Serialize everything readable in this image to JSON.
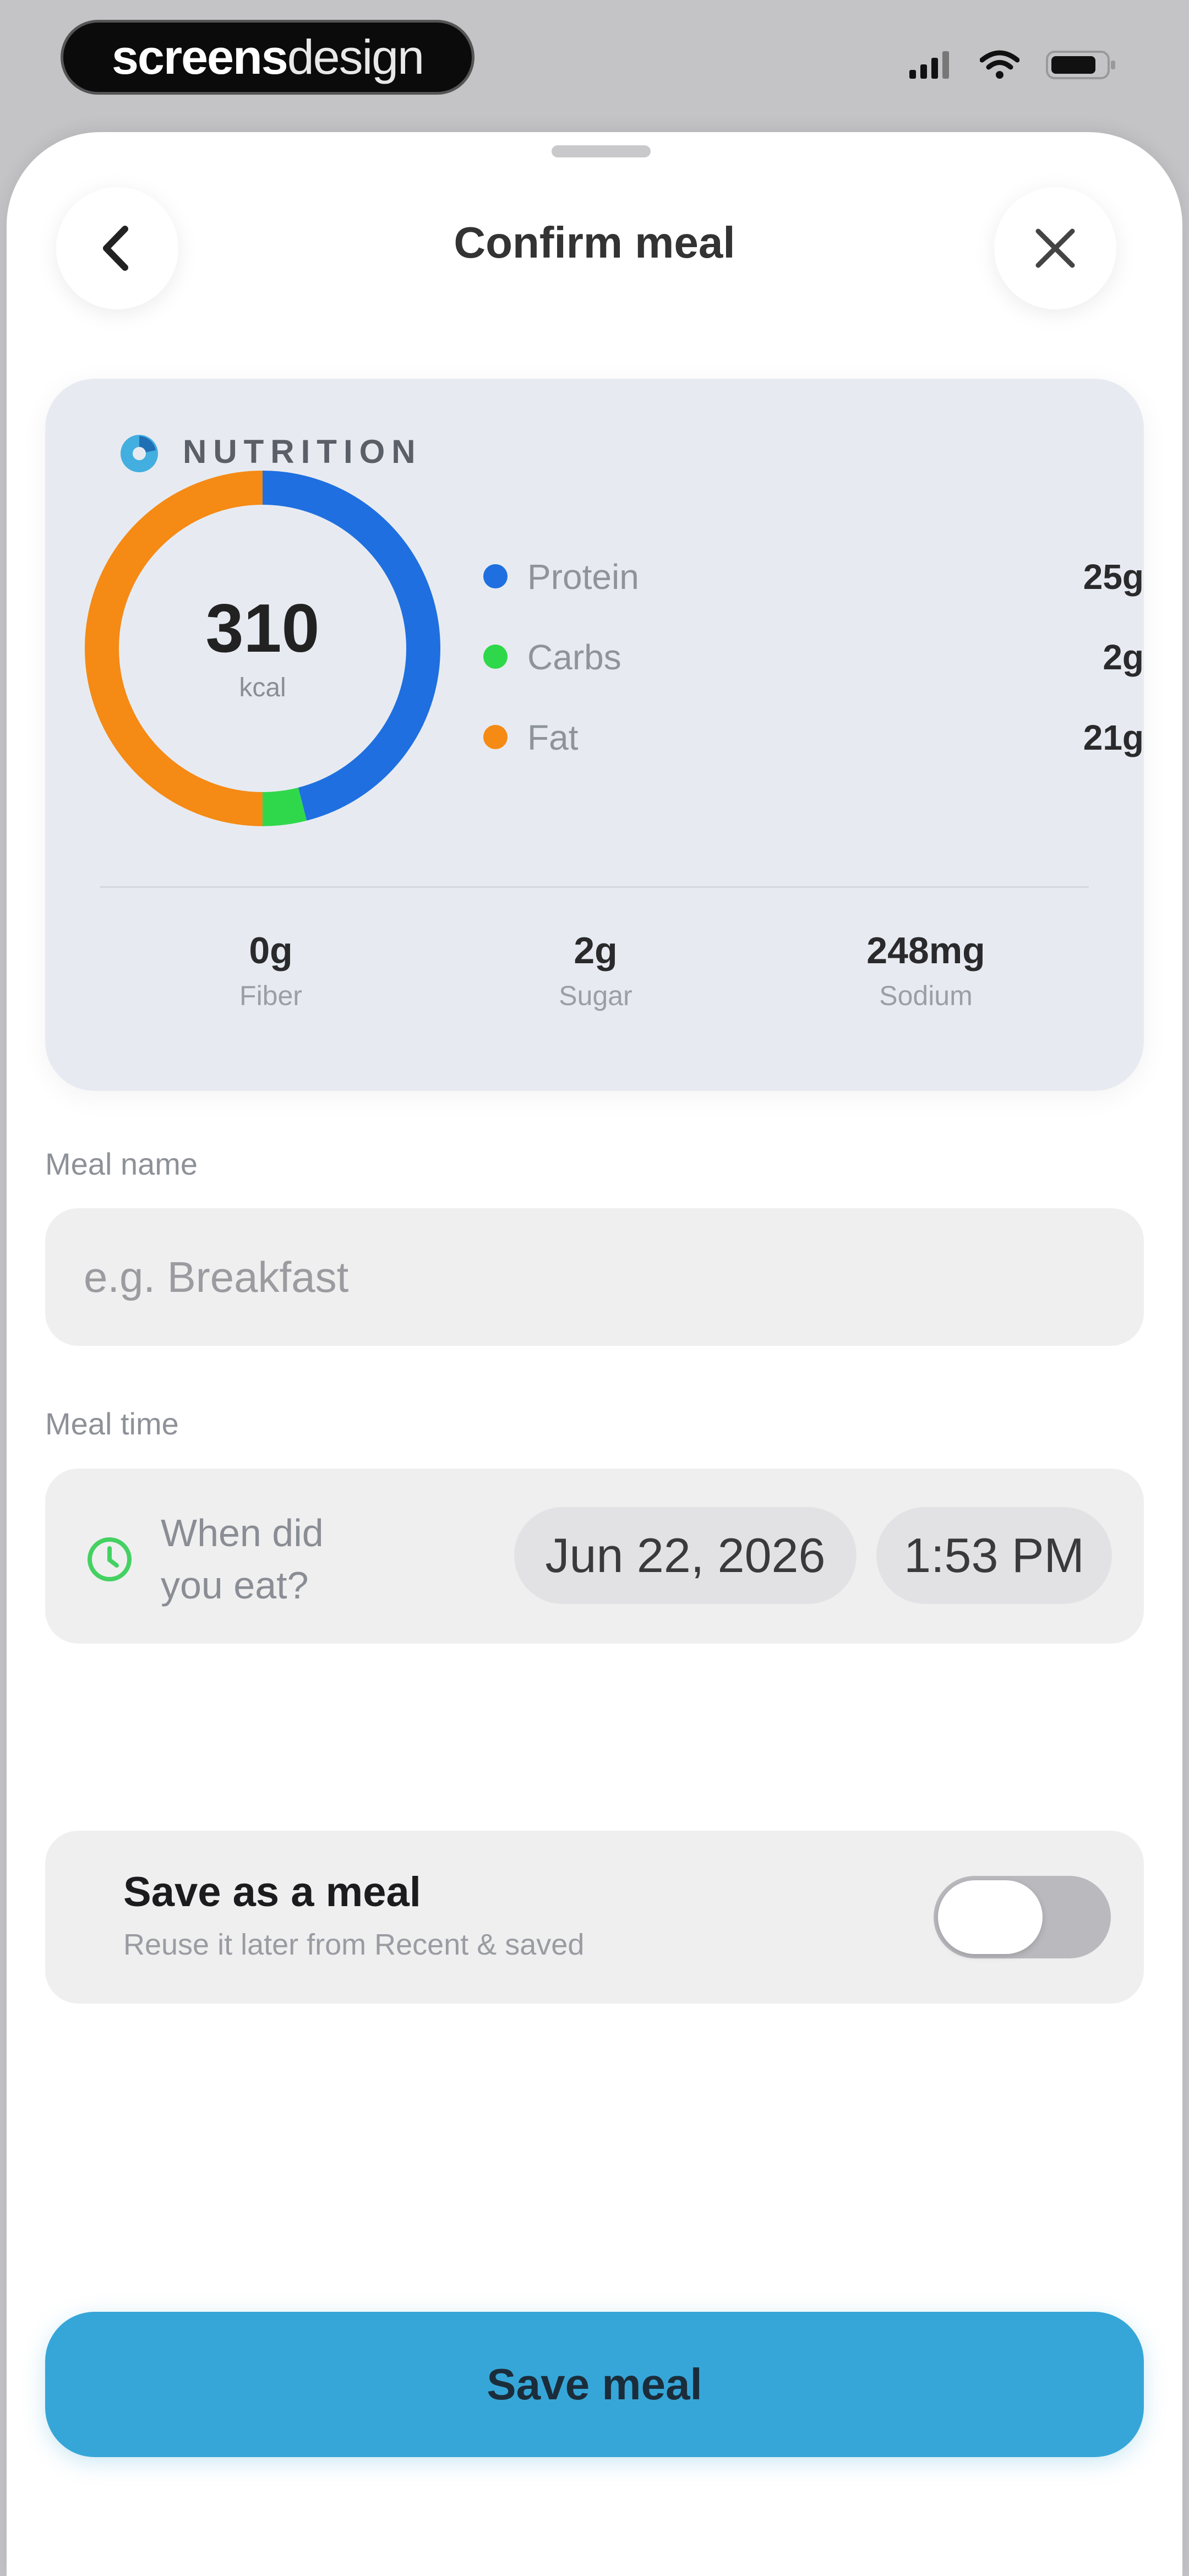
{
  "status_bar": {
    "brand_bold": "screens",
    "brand_light": "design"
  },
  "header": {
    "title": "Confirm meal",
    "back_icon": "chevron-left-icon",
    "close_icon": "close-icon"
  },
  "nutrition": {
    "label": "NUTRITION",
    "calories": "310",
    "calories_unit": "kcal",
    "macros": [
      {
        "name": "Protein",
        "value": "25g",
        "color": "#1f6fe0"
      },
      {
        "name": "Carbs",
        "value": "2g",
        "color": "#2fd84a"
      },
      {
        "name": "Fat",
        "value": "21g",
        "color": "#f58a14"
      }
    ],
    "ring_segments": [
      {
        "name": "Protein",
        "fraction": 0.46,
        "color": "#1f6fe0"
      },
      {
        "name": "Carbs",
        "fraction": 0.04,
        "color": "#2fd84a"
      },
      {
        "name": "Fat",
        "fraction": 0.5,
        "color": "#f58a14"
      }
    ],
    "micros": [
      {
        "value": "0g",
        "label": "Fiber"
      },
      {
        "value": "2g",
        "label": "Sugar"
      },
      {
        "value": "248mg",
        "label": "Sodium"
      }
    ]
  },
  "meal_name": {
    "label": "Meal name",
    "placeholder": "e.g. Breakfast",
    "value": ""
  },
  "meal_time": {
    "label": "Meal time",
    "question": "When did you eat?",
    "date": "Jun 22, 2026",
    "time": "1:53 PM"
  },
  "save_meal_toggle": {
    "title": "Save as a meal",
    "subtitle": "Reuse it later from Recent & saved",
    "on": false
  },
  "primary_action": {
    "label": "Save meal",
    "color": "#36a6d8"
  }
}
